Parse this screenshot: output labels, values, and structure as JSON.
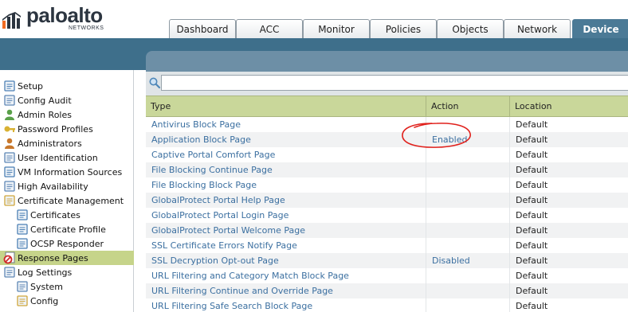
{
  "brand": {
    "name": "paloalto",
    "subtitle": "NETWORKS",
    "colors": {
      "dark": "#2c3540",
      "accent_orange": "#f26b21",
      "band_blue": "#3e6f8b",
      "selected_green": "#c6d48a"
    }
  },
  "tabs": [
    {
      "label": "Dashboard",
      "active": false
    },
    {
      "label": "ACC",
      "active": false
    },
    {
      "label": "Monitor",
      "active": false
    },
    {
      "label": "Policies",
      "active": false
    },
    {
      "label": "Objects",
      "active": false
    },
    {
      "label": "Network",
      "active": false
    },
    {
      "label": "Device",
      "active": true
    }
  ],
  "sidebar": {
    "items": [
      {
        "label": "Setup",
        "icon": "setup-icon",
        "level": 0
      },
      {
        "label": "Config Audit",
        "icon": "config-audit-icon",
        "level": 0
      },
      {
        "label": "Admin Roles",
        "icon": "admin-roles-icon",
        "level": 0
      },
      {
        "label": "Password Profiles",
        "icon": "password-profiles-icon",
        "level": 0
      },
      {
        "label": "Administrators",
        "icon": "administrators-icon",
        "level": 0
      },
      {
        "label": "User Identification",
        "icon": "user-identification-icon",
        "level": 0
      },
      {
        "label": "VM Information Sources",
        "icon": "vm-information-icon",
        "level": 0
      },
      {
        "label": "High Availability",
        "icon": "high-availability-icon",
        "level": 0
      },
      {
        "label": "Certificate Management",
        "icon": "certificate-management-icon",
        "level": 0
      },
      {
        "label": "Certificates",
        "icon": "certificates-icon",
        "level": 1
      },
      {
        "label": "Certificate Profile",
        "icon": "certificate-profile-icon",
        "level": 1
      },
      {
        "label": "OCSP Responder",
        "icon": "ocsp-responder-icon",
        "level": 1
      },
      {
        "label": "Response Pages",
        "icon": "response-pages-icon",
        "level": 0,
        "selected": true
      },
      {
        "label": "Log Settings",
        "icon": "log-settings-icon",
        "level": 0
      },
      {
        "label": "System",
        "icon": "system-log-icon",
        "level": 1
      },
      {
        "label": "Config",
        "icon": "config-log-icon",
        "level": 1
      }
    ]
  },
  "search": {
    "value": "",
    "placeholder": ""
  },
  "table": {
    "columns": [
      "Type",
      "Action",
      "Location"
    ],
    "rows": [
      {
        "type": "Antivirus Block Page",
        "action": "",
        "location": "Default"
      },
      {
        "type": "Application Block Page",
        "action": "Enabled",
        "location": "Default"
      },
      {
        "type": "Captive Portal Comfort Page",
        "action": "",
        "location": "Default"
      },
      {
        "type": "File Blocking Continue Page",
        "action": "",
        "location": "Default"
      },
      {
        "type": "File Blocking Block Page",
        "action": "",
        "location": "Default"
      },
      {
        "type": "GlobalProtect Portal Help Page",
        "action": "",
        "location": "Default"
      },
      {
        "type": "GlobalProtect Portal Login Page",
        "action": "",
        "location": "Default"
      },
      {
        "type": "GlobalProtect Portal Welcome Page",
        "action": "",
        "location": "Default"
      },
      {
        "type": "SSL Certificate Errors Notify Page",
        "action": "",
        "location": "Default"
      },
      {
        "type": "SSL Decryption Opt-out Page",
        "action": "Disabled",
        "location": "Default"
      },
      {
        "type": "URL Filtering and Category Match Block Page",
        "action": "",
        "location": "Default"
      },
      {
        "type": "URL Filtering Continue and Override Page",
        "action": "",
        "location": "Default"
      },
      {
        "type": "URL Filtering Safe Search Block Page",
        "action": "",
        "location": "Default"
      }
    ]
  },
  "annotation": {
    "shape": "hand-drawn-circle",
    "color": "#e0201b",
    "target": "Enabled"
  }
}
